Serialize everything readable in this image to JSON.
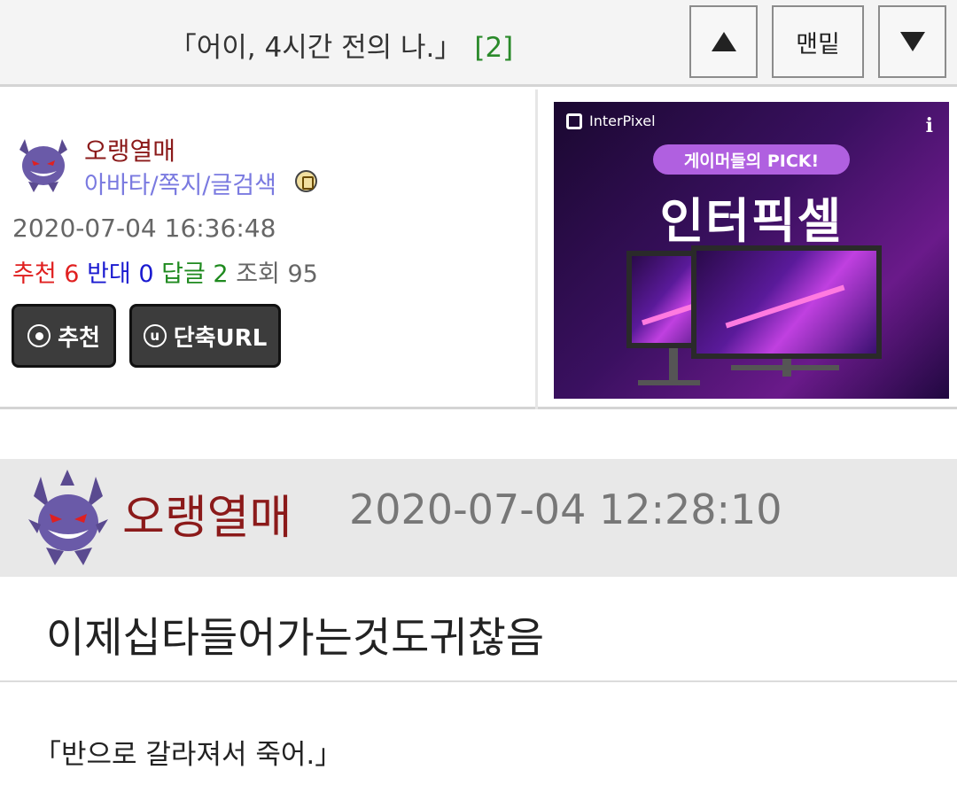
{
  "header": {
    "title": "「어이, 4시간 전의 나.」",
    "comment_count": "[2]",
    "bottom_label": "맨밑"
  },
  "post_info": {
    "author": "오랭열매",
    "author_links": "아바타/쪽지/글검색",
    "date": "2020-07-04 16:36:48",
    "recommend_label": "추천",
    "recommend_count": "6",
    "oppose_label": "반대",
    "oppose_count": "0",
    "reply_label": "답글",
    "reply_count": "2",
    "view_label": "조회",
    "view_count": "95",
    "recommend_button": "추천",
    "shorturl_button": "단축URL",
    "shorturl_icon_letter": "u"
  },
  "ad": {
    "brand": "InterPixel",
    "info_icon": "i",
    "pill": "게이머들의 PICK!",
    "headline": "인터픽셀"
  },
  "comment": {
    "author": "오랭열매",
    "date": "2020-07-04 12:28:10",
    "body": "이제십타들어가는것도귀찮음"
  },
  "next_post": {
    "title": "「반으로 갈라져서 죽어.」"
  },
  "colors": {
    "author": "#8b1a1a",
    "recommend": "#e02020",
    "oppose": "#1a1ad0",
    "reply": "#1f8a1f",
    "links": "#7a7ae0"
  },
  "icons": [
    "up-arrow-icon",
    "down-arrow-icon",
    "avatar-gengar-icon",
    "badge-icon",
    "recommend-circle-icon",
    "url-circle-icon",
    "ad-info-icon"
  ]
}
